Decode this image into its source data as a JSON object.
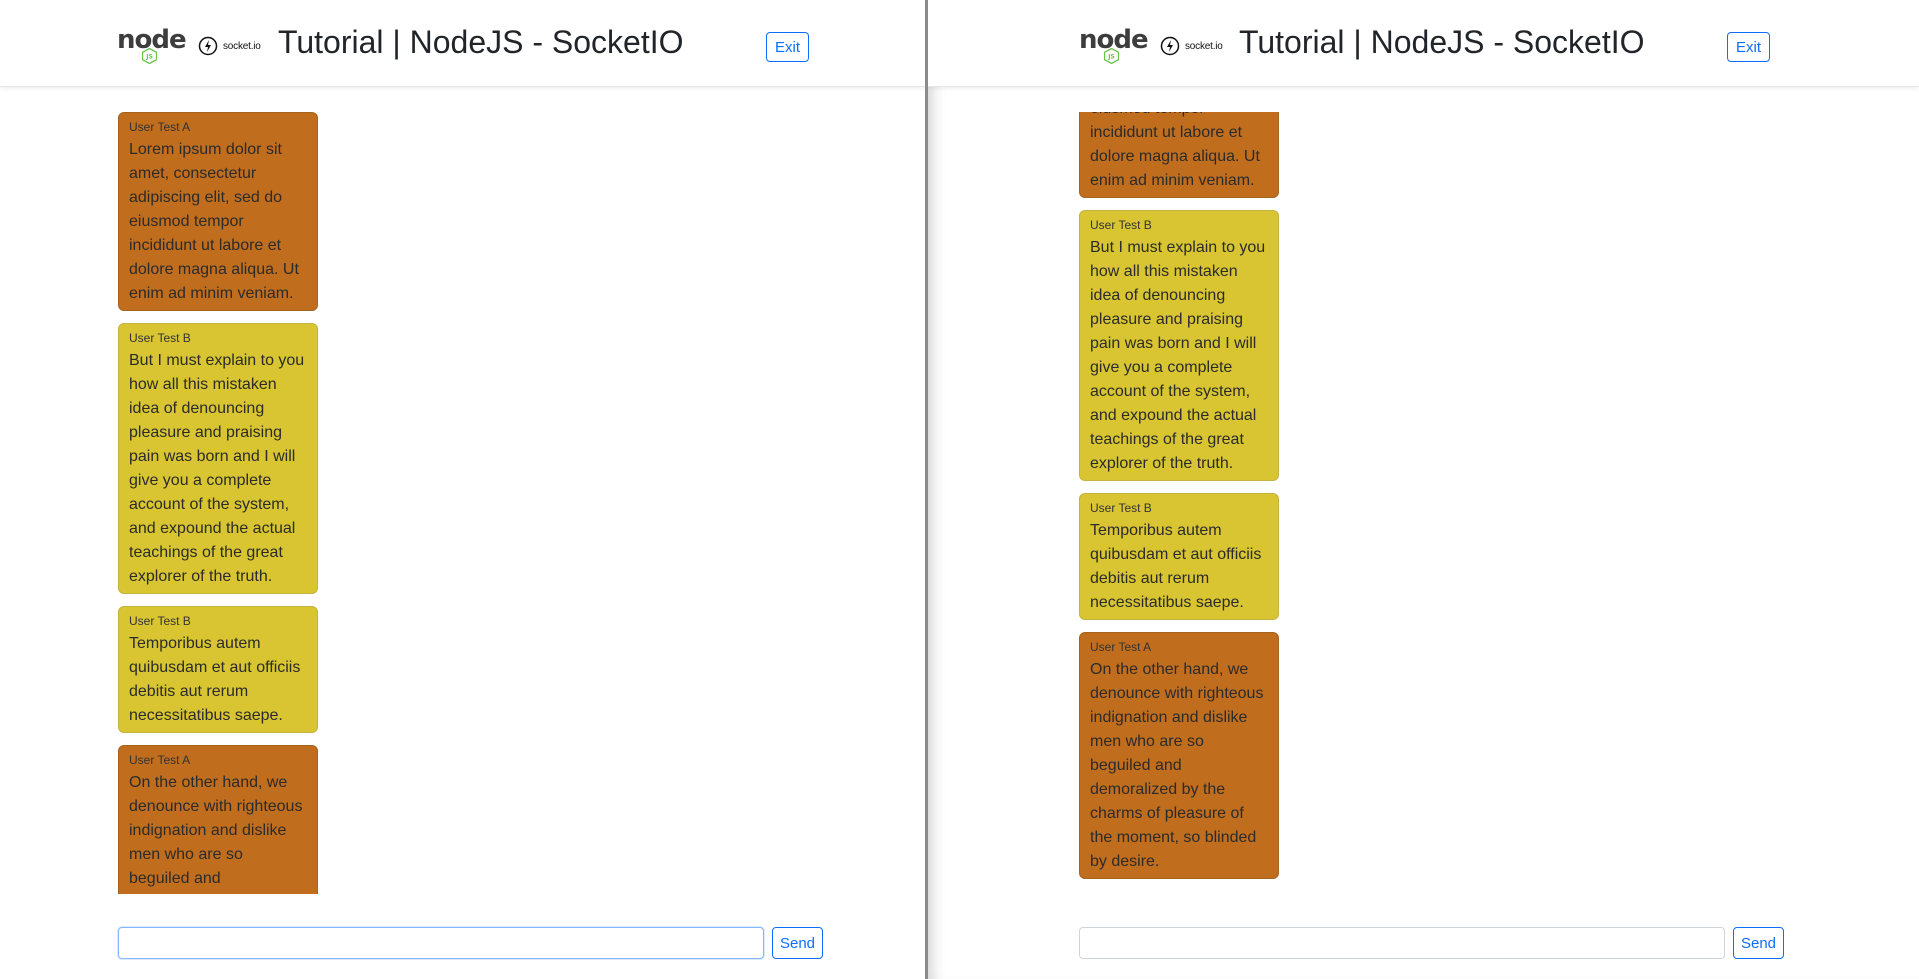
{
  "header": {
    "title": "Tutorial | NodeJS - SocketIO",
    "node_logo_text": "node",
    "node_logo_badge": "JS",
    "socketio_logo_text": "socket.io",
    "exit_label": "Exit"
  },
  "composer": {
    "input_value": "",
    "send_label": "Send"
  },
  "messages": [
    {
      "user": "User Test A",
      "text": "Lorem ipsum dolor sit amet, consectetur adipiscing elit, sed do eiusmod tempor incididunt ut labore et dolore magna aliqua. Ut enim ad minim veniam.",
      "color": "#c06d1e"
    },
    {
      "user": "User Test B",
      "text": "But I must explain to you how all this mistaken idea of denouncing pleasure and praising pain was born and I will give you a complete account of the system, and expound the actual teachings of the great explorer of the truth.",
      "color": "#d8c531"
    },
    {
      "user": "User Test B",
      "text": "Temporibus autem quibusdam et aut officiis debitis aut rerum necessitatibus saepe.",
      "color": "#d8c531"
    },
    {
      "user": "User Test A",
      "text": "On the other hand, we denounce with righteous indignation and dislike men who are so beguiled and demoralized by the charms of pleasure of the moment, so blinded by desire.",
      "color": "#c06d1e"
    }
  ],
  "colors": {
    "user_a": "#c06d1e",
    "user_b": "#d8c531",
    "accent": "#0d6efd",
    "node_green": "#6cc24a"
  },
  "icons": [
    "node-js-logo-icon",
    "socket-io-logo-icon"
  ]
}
